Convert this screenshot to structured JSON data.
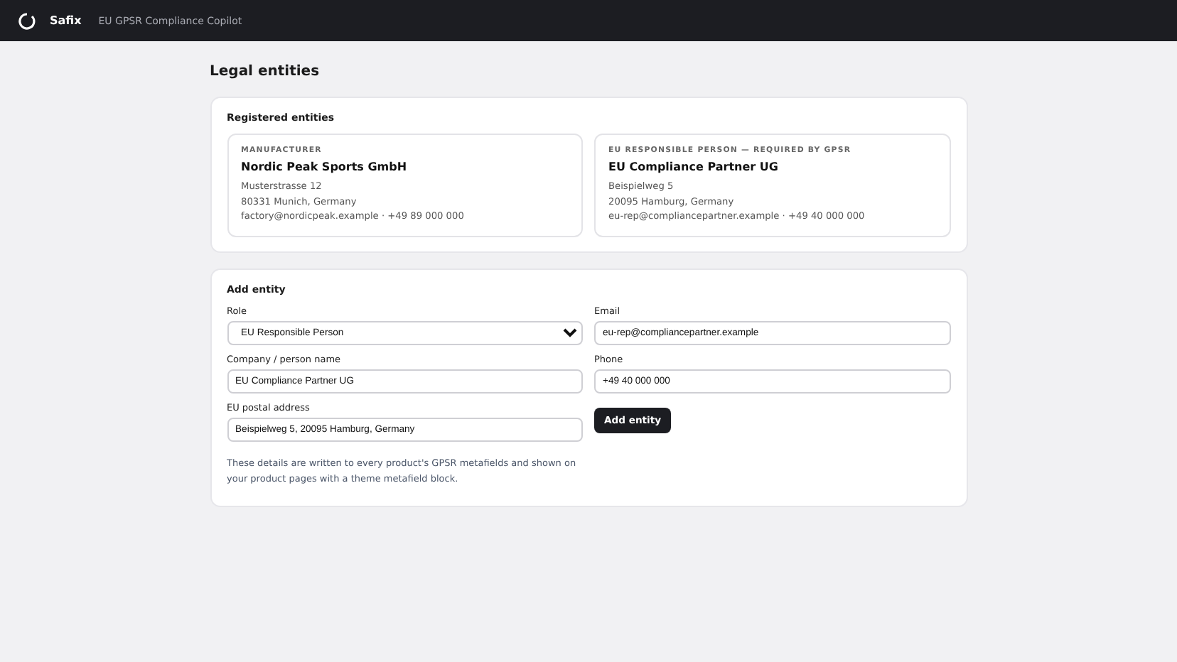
{
  "app": {
    "name": "Safix",
    "subtitle": "EU GPSR Compliance Copilot"
  },
  "page": {
    "title": "Legal entities"
  },
  "registered": {
    "title": "Registered entities",
    "entities": [
      {
        "role": "MANUFACTURER",
        "name": "Nordic Peak Sports GmbH",
        "street": "Musterstrasse 12",
        "city": "80331 Munich, Germany",
        "contact": "factory@nordicpeak.example · +49 89 000 000"
      },
      {
        "role": "EU RESPONSIBLE PERSON — REQUIRED BY GPSR",
        "name": "EU Compliance Partner UG",
        "street": "Beispielweg 5",
        "city": "20095 Hamburg, Germany",
        "contact": "eu-rep@compliancepartner.example · +49 40 000 000"
      }
    ]
  },
  "add_entity": {
    "title": "Add entity",
    "left_fields": [
      {
        "kind": "select",
        "label": "Role",
        "value": "EU Responsible Person"
      },
      {
        "kind": "text",
        "label": "Company / person name",
        "value": "EU Compliance Partner UG"
      },
      {
        "kind": "text",
        "label": "EU postal address",
        "value": "Beispielweg 5, 20095 Hamburg, Germany"
      }
    ],
    "right_fields": [
      {
        "kind": "text",
        "label": "Email",
        "value": "eu-rep@compliancepartner.example"
      },
      {
        "kind": "text",
        "label": "Phone",
        "value": "+49 40 000 000"
      }
    ],
    "button": "Add entity",
    "note": "These details are written to every product's GPSR metafields and shown on your product pages with a theme metafield block."
  }
}
